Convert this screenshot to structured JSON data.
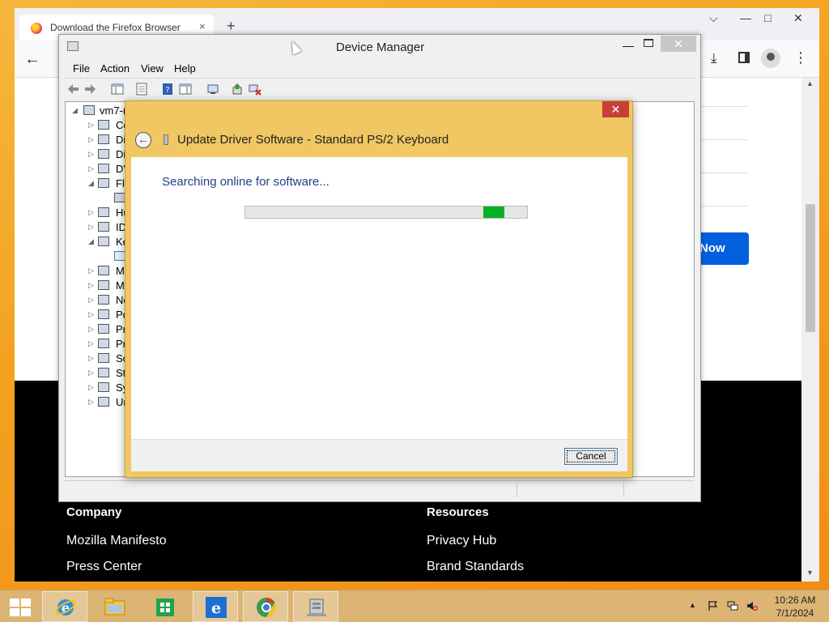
{
  "browser": {
    "tab_title": "Download the Firefox Browser",
    "tab_close": "×",
    "new_tab": "+",
    "window_controls": {
      "chevron": "⌵",
      "minimize": "—",
      "maximize": "□",
      "close": "✕"
    },
    "back": "←",
    "download_icon": "⤓",
    "menu_icon": "⋮",
    "download_button": "Now",
    "footer": {
      "col1_heading": "Company",
      "col1_links": [
        "Mozilla Manifesto",
        "Press Center"
      ],
      "col2_heading": "Resources",
      "col2_links": [
        "Privacy Hub",
        "Brand Standards"
      ]
    }
  },
  "device_manager": {
    "title": "Device Manager",
    "minimize": "—",
    "close": "✕",
    "menu": [
      "File",
      "Action",
      "View",
      "Help"
    ],
    "tree_root": "vm7-(",
    "tree_items": [
      {
        "arrow": "▷",
        "label": "Co"
      },
      {
        "arrow": "▷",
        "label": "Di"
      },
      {
        "arrow": "▷",
        "label": "Di"
      },
      {
        "arrow": "▷",
        "label": "DV"
      },
      {
        "arrow": "◢",
        "label": "Flo"
      },
      {
        "arrow": "",
        "label": ""
      },
      {
        "arrow": "▷",
        "label": "Hu"
      },
      {
        "arrow": "▷",
        "label": "ID"
      },
      {
        "arrow": "◢",
        "label": "Ke"
      },
      {
        "arrow": "",
        "label": ""
      },
      {
        "arrow": "▷",
        "label": "M"
      },
      {
        "arrow": "▷",
        "label": "M"
      },
      {
        "arrow": "▷",
        "label": "Ne"
      },
      {
        "arrow": "▷",
        "label": "Po"
      },
      {
        "arrow": "▷",
        "label": "Pr"
      },
      {
        "arrow": "▷",
        "label": "Pr"
      },
      {
        "arrow": "▷",
        "label": "So"
      },
      {
        "arrow": "▷",
        "label": "St"
      },
      {
        "arrow": "▷",
        "label": "Sy"
      },
      {
        "arrow": "▷",
        "label": "Ur"
      }
    ]
  },
  "update_driver": {
    "title": "Update Driver Software - Standard PS/2 Keyboard",
    "close": "✕",
    "back": "←",
    "status": "Searching online for software...",
    "progress_marquee": 0.92,
    "cancel": "Cancel"
  },
  "taskbar": {
    "apps": [
      "start",
      "internet-explorer",
      "file-explorer",
      "store",
      "internet-explorer",
      "chrome",
      "device-manager"
    ],
    "clock_time": "10:26 AM",
    "clock_date": "7/1/2024",
    "tray_arrow": "▲"
  },
  "colors": {
    "dialog_frame": "#f0c763",
    "progress_fill": "#06b025",
    "accent_blue": "#0060df",
    "dialog_close_red": "#c74038"
  }
}
